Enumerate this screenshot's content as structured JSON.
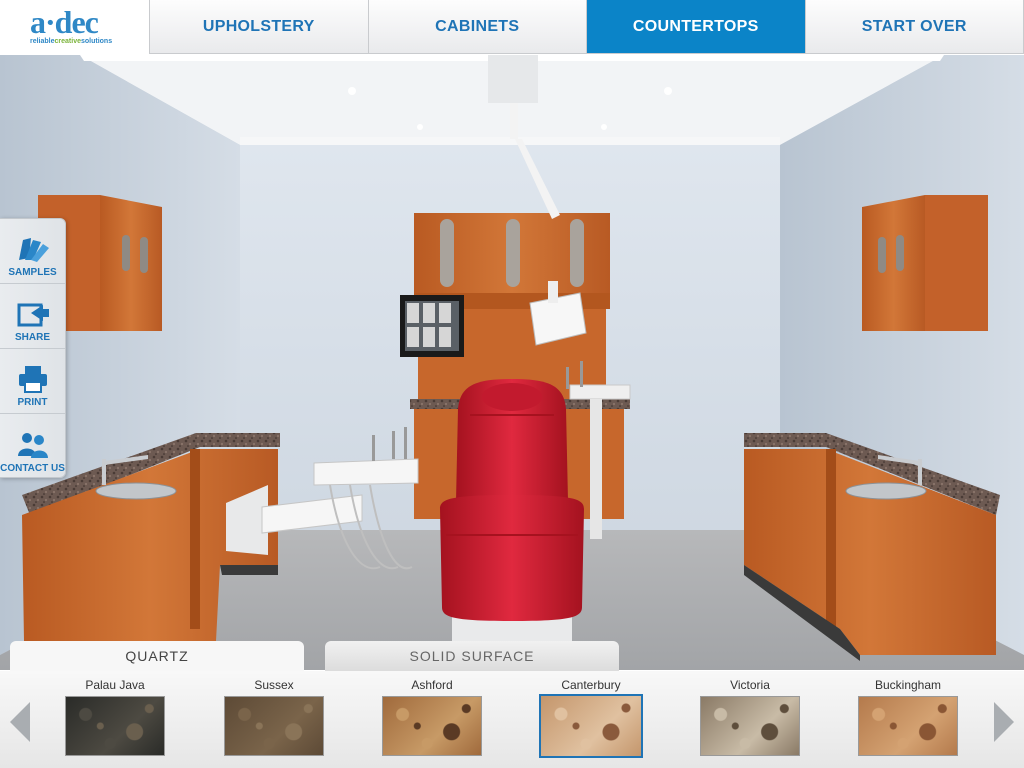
{
  "brand": {
    "name": "a·dec",
    "tagline_a": "reliable",
    "tagline_b": "creative",
    "tagline_c": "solutions"
  },
  "nav": {
    "tabs": [
      {
        "label": "UPHOLSTERY",
        "active": false
      },
      {
        "label": "CABINETS",
        "active": false
      },
      {
        "label": "COUNTERTOPS",
        "active": true
      },
      {
        "label": "START OVER",
        "active": false
      }
    ]
  },
  "sidebar": {
    "items": [
      {
        "label": "SAMPLES",
        "icon": "swatch-fan-icon"
      },
      {
        "label": "SHARE",
        "icon": "share-icon"
      },
      {
        "label": "PRINT",
        "icon": "printer-icon"
      },
      {
        "label": "CONTACT US",
        "icon": "people-icon"
      }
    ]
  },
  "material_tabs": [
    {
      "label": "QUARTZ",
      "active": true
    },
    {
      "label": "SOLID SURFACE",
      "active": false
    }
  ],
  "swatches": [
    {
      "name": "Palau Java",
      "colors": [
        "#2a2b28",
        "#4d4a42",
        "#6a5f4e"
      ],
      "selected": false
    },
    {
      "name": "Sussex",
      "colors": [
        "#5d4a36",
        "#7a644a",
        "#8a7458"
      ],
      "selected": false
    },
    {
      "name": "Ashford",
      "colors": [
        "#a06a3c",
        "#c79a66",
        "#5a3a24"
      ],
      "selected": false
    },
    {
      "name": "Canterbury",
      "colors": [
        "#c4966c",
        "#e0c1a0",
        "#8a5a3c"
      ],
      "selected": true
    },
    {
      "name": "Victoria",
      "colors": [
        "#8a7a66",
        "#c8bba6",
        "#5e4e3c"
      ],
      "selected": false
    },
    {
      "name": "Buckingham",
      "colors": [
        "#b47a4c",
        "#d4a272",
        "#8a5634"
      ],
      "selected": false
    }
  ],
  "colors": {
    "accent": "#0b84c8",
    "nav_text": "#1f74b6",
    "cabinet_wood": "#c86a30",
    "chair_red": "#d9233a",
    "countertop": "#6e5a52"
  }
}
